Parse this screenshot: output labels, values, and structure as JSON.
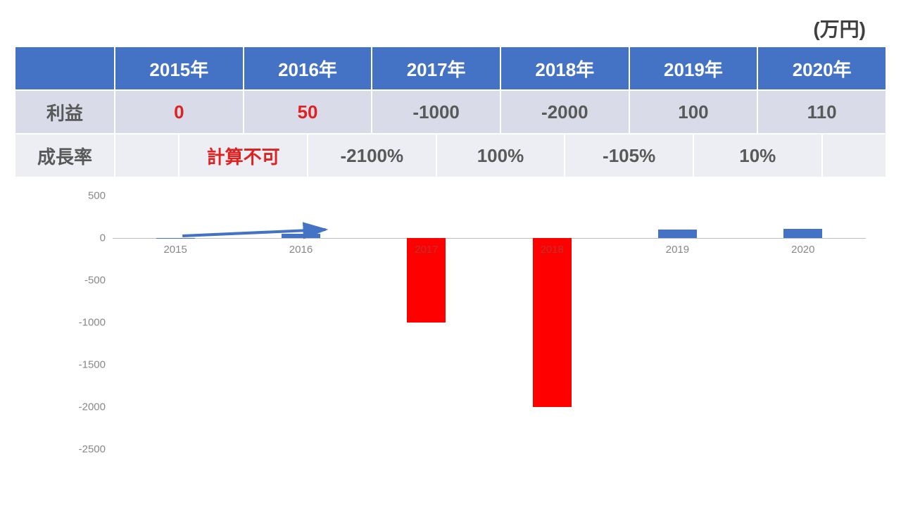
{
  "unit": "(万円)",
  "table": {
    "row_labels": [
      "利益",
      "成長率"
    ],
    "years": [
      "2015年",
      "2016年",
      "2017年",
      "2018年",
      "2019年",
      "2020年"
    ],
    "profit": [
      "0",
      "50",
      "-1000",
      "-2000",
      "100",
      "110"
    ],
    "growth": [
      "計算不可",
      "-2100%",
      "100%",
      "-105%",
      "10%"
    ]
  },
  "chart_data": {
    "type": "bar",
    "categories": [
      "2015",
      "2016",
      "2017",
      "2018",
      "2019",
      "2020"
    ],
    "values": [
      0,
      50,
      -1000,
      -2000,
      100,
      110
    ],
    "ylabel": "",
    "xlabel": "",
    "title": "",
    "ylim": [
      -2500,
      500
    ],
    "yticks": [
      500,
      0,
      -500,
      -1000,
      -1500,
      -2000,
      -2500
    ],
    "annotation": "arrow from 2015 bar to 2016 bar",
    "colors": {
      "positive": "#4472c4",
      "negative": "#f00"
    }
  }
}
